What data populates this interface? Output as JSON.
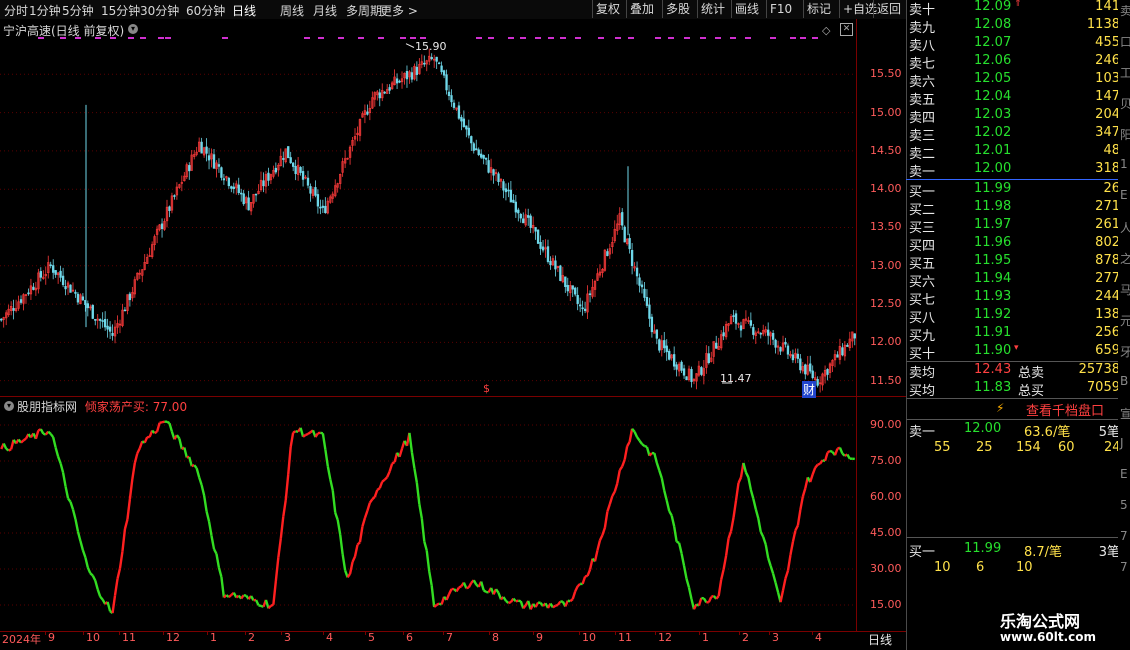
{
  "toolbar": {
    "periods": [
      "分时",
      "1分钟",
      "5分钟",
      "15分钟",
      "30分钟",
      "60分钟",
      "日线",
      "周线",
      "月线",
      "多周期",
      "更多 >"
    ],
    "active_period": "日线",
    "buttons": [
      "复权",
      "叠加",
      "多股",
      "统计",
      "画线",
      "F10",
      "标记",
      "+自选",
      "返回"
    ]
  },
  "price_chart": {
    "title": "宁沪高速(日线 前复权)",
    "y_ticks": [
      "15.50",
      "15.00",
      "14.50",
      "14.00",
      "13.50",
      "13.00",
      "12.50",
      "12.00",
      "11.50"
    ],
    "high_label": "15.90",
    "low_label": "11.47",
    "marker_dollar": "$",
    "marker_cai": "财",
    "colors": {
      "up": "#ff3b3b",
      "down": "#6fd8ea",
      "grid": "#5a0000"
    }
  },
  "indicator": {
    "name": "股朋指标网",
    "label": "倾家荡产买:",
    "value": "77.00",
    "y_ticks": [
      "90.00",
      "75.00",
      "60.00",
      "45.00",
      "30.00",
      "15.00"
    ],
    "colors": {
      "up": "#ff2020",
      "down": "#33dd22"
    }
  },
  "x_axis": {
    "year": "2024年",
    "months": [
      "9",
      "10",
      "11",
      "12",
      "1",
      "2",
      "3",
      "4",
      "5",
      "6",
      "7",
      "8",
      "9",
      "10",
      "11",
      "12",
      "1",
      "2",
      "3",
      "4"
    ],
    "period": "日线"
  },
  "chart_data": [
    {
      "type": "candlestick",
      "title": "宁沪高速(日线 前复权)",
      "ylim": [
        11.3,
        16.0
      ],
      "max_label": 15.9,
      "min_label": 11.47,
      "close_waypoints": [
        [
          0,
          12.3
        ],
        [
          20,
          13.0
        ],
        [
          45,
          12.1
        ],
        [
          60,
          13.2
        ],
        [
          80,
          14.6
        ],
        [
          100,
          13.8
        ],
        [
          115,
          14.5
        ],
        [
          130,
          13.7
        ],
        [
          150,
          15.2
        ],
        [
          175,
          15.7
        ],
        [
          190,
          14.6
        ],
        [
          210,
          13.7
        ],
        [
          235,
          12.4
        ],
        [
          250,
          13.6
        ],
        [
          265,
          12.0
        ],
        [
          280,
          11.5
        ],
        [
          295,
          12.3
        ],
        [
          310,
          12.1
        ],
        [
          330,
          11.5
        ],
        [
          345,
          12.1
        ]
      ]
    },
    {
      "type": "line",
      "title": "倾家荡产买",
      "ylim": [
        5,
        95
      ],
      "last_value": 77.0,
      "waypoints": [
        [
          0,
          80
        ],
        [
          20,
          88
        ],
        [
          35,
          30
        ],
        [
          45,
          11
        ],
        [
          55,
          80
        ],
        [
          66,
          92
        ],
        [
          80,
          70
        ],
        [
          90,
          20
        ],
        [
          110,
          15
        ],
        [
          118,
          88
        ],
        [
          130,
          85
        ],
        [
          140,
          25
        ],
        [
          150,
          60
        ],
        [
          165,
          85
        ],
        [
          175,
          15
        ],
        [
          190,
          25
        ],
        [
          210,
          15
        ],
        [
          230,
          15
        ],
        [
          240,
          35
        ],
        [
          255,
          88
        ],
        [
          265,
          75
        ],
        [
          280,
          15
        ],
        [
          290,
          20
        ],
        [
          300,
          75
        ],
        [
          315,
          15
        ],
        [
          325,
          65
        ],
        [
          335,
          80
        ],
        [
          345,
          77
        ]
      ]
    }
  ],
  "book": {
    "sell": [
      {
        "label": "卖十",
        "price": "12.09",
        "vol": "141"
      },
      {
        "label": "卖九",
        "price": "12.08",
        "vol": "1138"
      },
      {
        "label": "卖八",
        "price": "12.07",
        "vol": "455"
      },
      {
        "label": "卖七",
        "price": "12.06",
        "vol": "246"
      },
      {
        "label": "卖六",
        "price": "12.05",
        "vol": "103"
      },
      {
        "label": "卖五",
        "price": "12.04",
        "vol": "147"
      },
      {
        "label": "卖四",
        "price": "12.03",
        "vol": "204"
      },
      {
        "label": "卖三",
        "price": "12.02",
        "vol": "347"
      },
      {
        "label": "卖二",
        "price": "12.01",
        "vol": "48"
      },
      {
        "label": "卖一",
        "price": "12.00",
        "vol": "318"
      }
    ],
    "buy": [
      {
        "label": "买一",
        "price": "11.99",
        "vol": "26"
      },
      {
        "label": "买二",
        "price": "11.98",
        "vol": "271"
      },
      {
        "label": "买三",
        "price": "11.97",
        "vol": "261"
      },
      {
        "label": "买四",
        "price": "11.96",
        "vol": "802"
      },
      {
        "label": "买五",
        "price": "11.95",
        "vol": "878"
      },
      {
        "label": "买六",
        "price": "11.94",
        "vol": "277"
      },
      {
        "label": "买七",
        "price": "11.93",
        "vol": "244"
      },
      {
        "label": "买八",
        "price": "11.92",
        "vol": "138"
      },
      {
        "label": "买九",
        "price": "11.91",
        "vol": "256"
      },
      {
        "label": "买十",
        "price": "11.90",
        "vol": "659"
      }
    ],
    "avg_sell_label": "卖均",
    "avg_sell_price": "12.43",
    "total_sell_label": "总卖",
    "total_sell_vol": "25738",
    "avg_buy_label": "买均",
    "avg_buy_price": "11.83",
    "total_buy_label": "总买",
    "total_buy_vol": "7059",
    "thousand_btn": "查看千档盘口",
    "sell1_queue": {
      "label": "卖一",
      "price": "12.00",
      "per": "63.6/笔",
      "count": "5笔",
      "orders": [
        "55",
        "25",
        "154",
        "60",
        "24"
      ]
    },
    "buy1_queue": {
      "label": "买一",
      "price": "11.99",
      "per": "8.7/笔",
      "count": "3笔",
      "orders": [
        "10",
        "6",
        "10"
      ]
    }
  },
  "side_strip_chars": [
    "卖",
    "口",
    "工",
    "贝",
    "阳",
    "1",
    "E",
    "人",
    "之",
    "马",
    "元",
    "牙",
    "B",
    "宣",
    "J",
    "E",
    "5",
    "7",
    "7"
  ],
  "brand": {
    "line1": "乐淘公式网",
    "line2": "www.60lt.com"
  }
}
